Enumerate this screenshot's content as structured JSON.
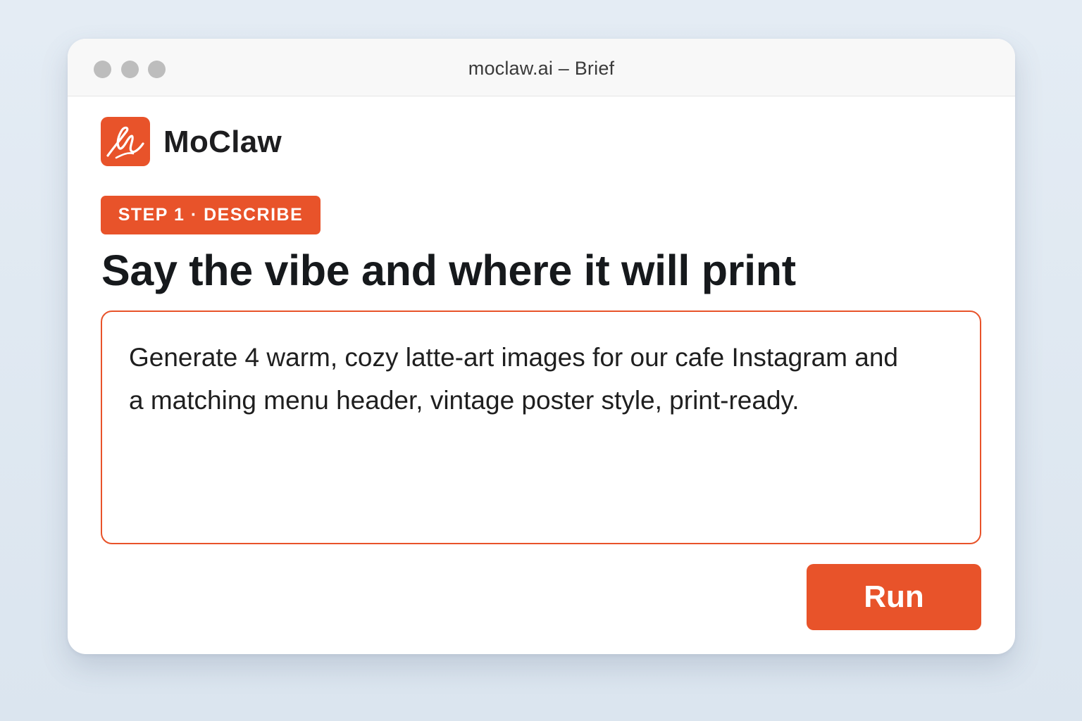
{
  "window": {
    "title": "moclaw.ai – Brief"
  },
  "brand": {
    "name": "MoClaw",
    "logo_icon": "claw-scribble-logo-icon",
    "accent_color": "#e8532a"
  },
  "step": {
    "badge_label": "STEP 1 · DESCRIBE"
  },
  "main": {
    "heading": "Say the vibe and where it will print",
    "brief_text": "Generate 4 warm, cozy latte-art images for our cafe Instagram and a matching menu header, vintage poster style, print-ready."
  },
  "actions": {
    "run_label": "Run"
  }
}
